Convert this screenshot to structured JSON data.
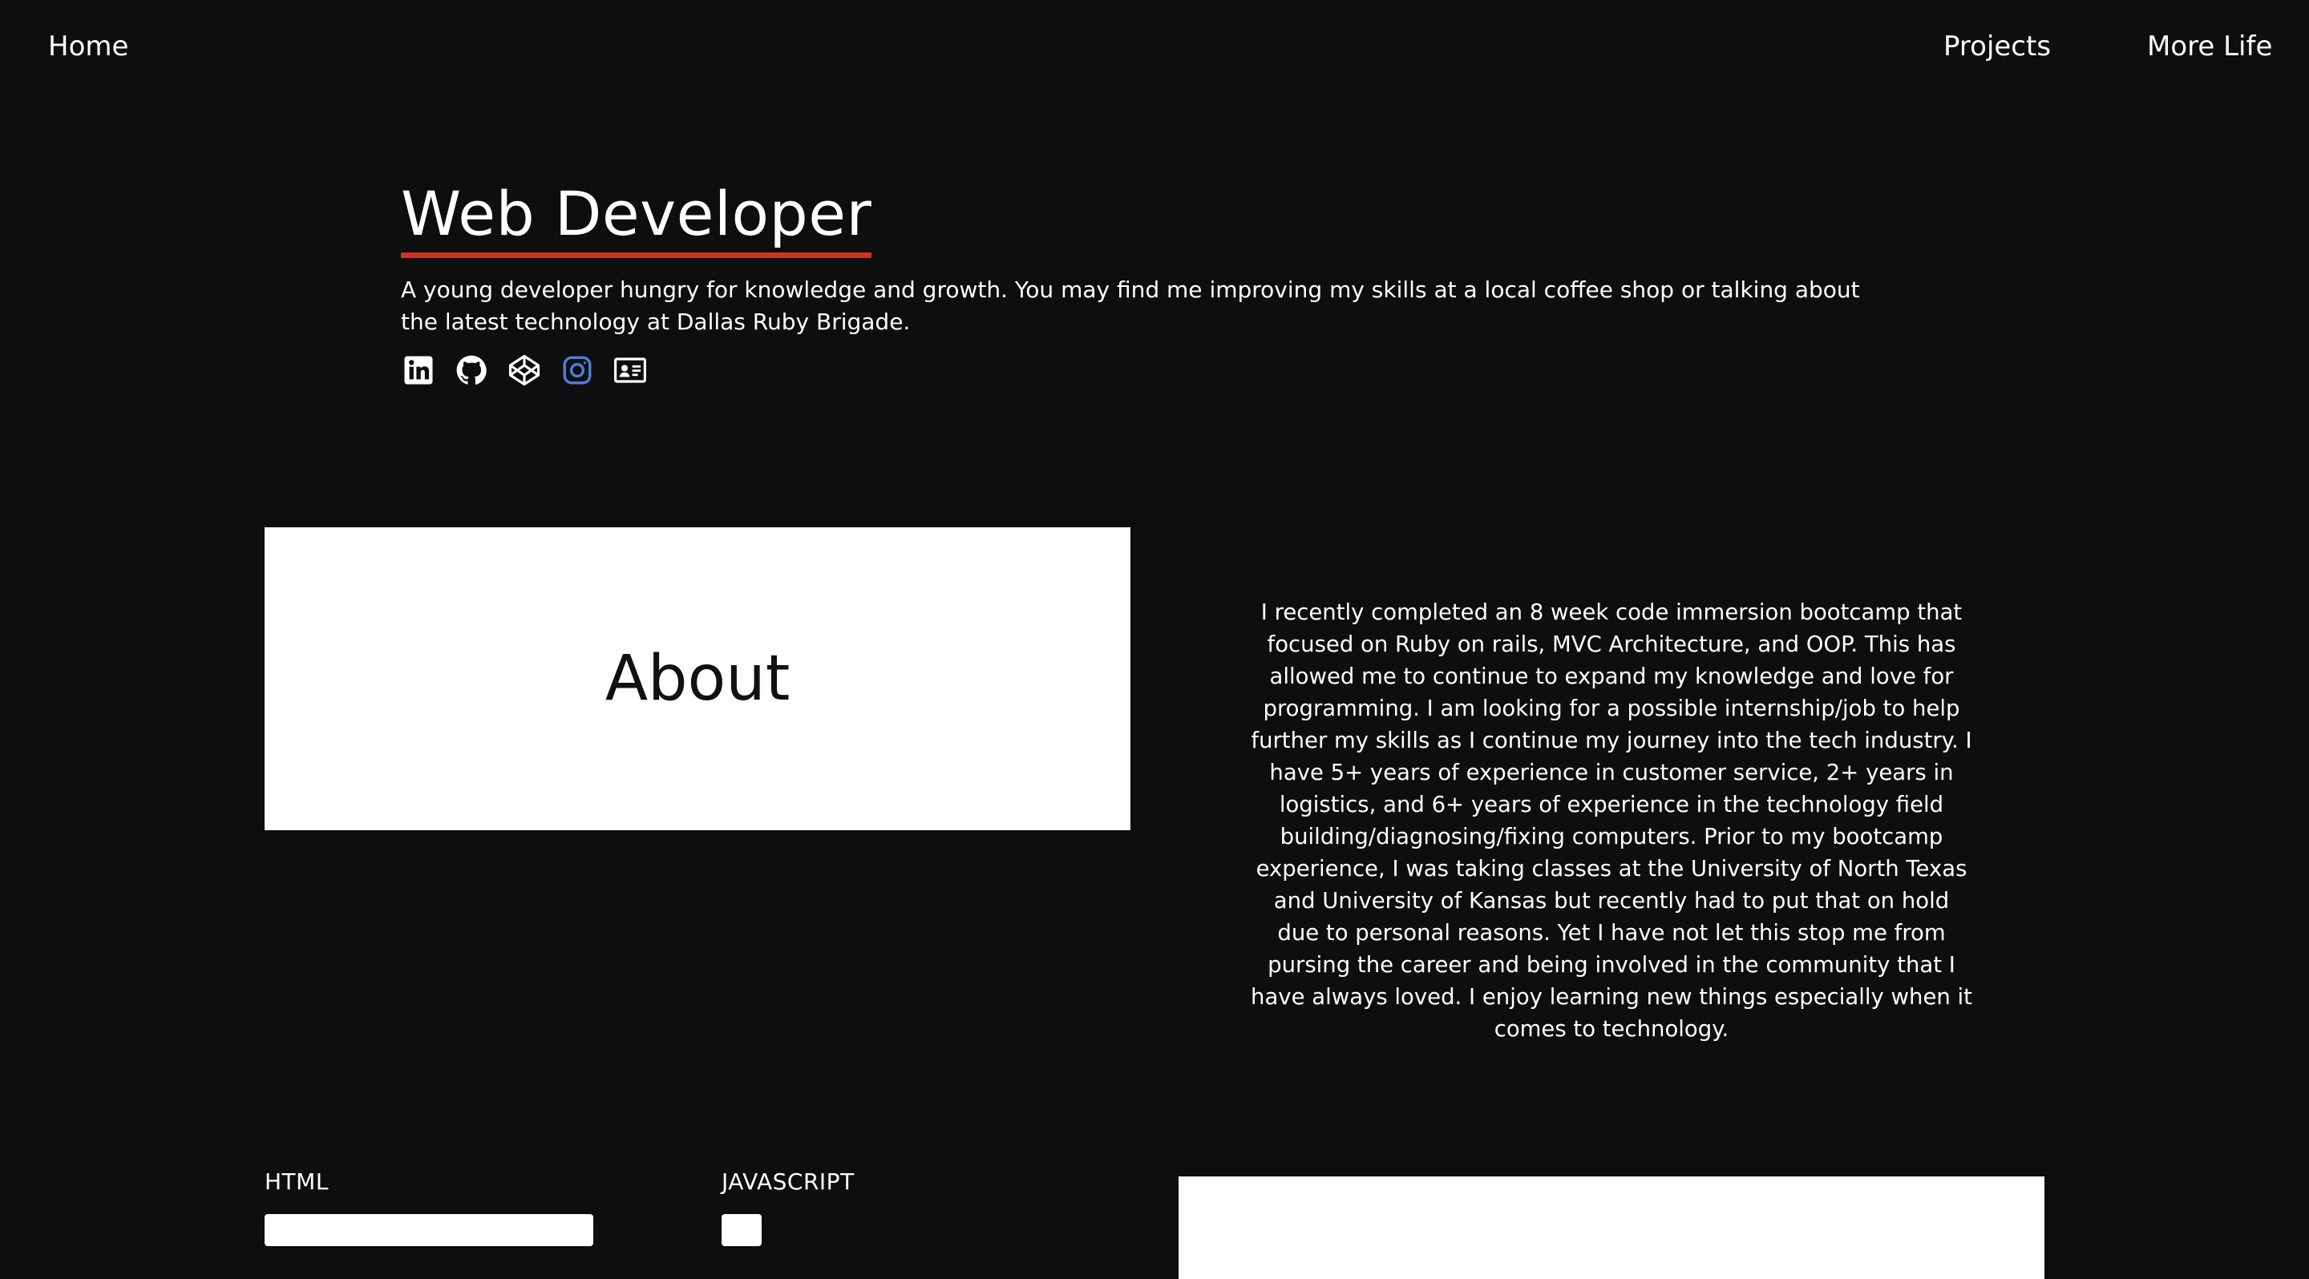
{
  "nav": {
    "home": "Home",
    "projects": "Projects",
    "more_life": "More Life"
  },
  "hero": {
    "title": "Web Developer",
    "description": "A young developer hungry for knowledge and growth. You may find me improving my skills at a local coffee shop or talking about the latest technology at Dallas Ruby Brigade.",
    "accent_color": "#d2321f",
    "social_icons": [
      "linkedin-icon",
      "github-icon",
      "codepen-icon",
      "instagram-icon",
      "contact-card-icon"
    ],
    "instagram_color": "#4a7fd4"
  },
  "about": {
    "heading": "About",
    "body": "I recently completed an 8 week code immersion bootcamp that focused on Ruby on rails, MVC Architecture, and OOP. This has allowed me to continue to expand my knowledge and love for programming. I am looking for a possible internship/job to help further my skills as I continue my journey into the tech industry. I have 5+ years of experience in customer service, 2+ years in logistics, and 6+ years of experience in the technology field building/diagnosing/fixing computers. Prior to my bootcamp experience, I was taking classes at the University of North Texas and University of Kansas but recently had to put that on hold due to personal reasons. Yet I have not let this stop me from pursing the career and being involved in the community that I have always loved. I enjoy learning new things especially when it comes to technology."
  },
  "skills": [
    {
      "label": "HTML",
      "level": 0.41
    },
    {
      "label": "JAVASCRIPT",
      "level": 0.05
    }
  ]
}
